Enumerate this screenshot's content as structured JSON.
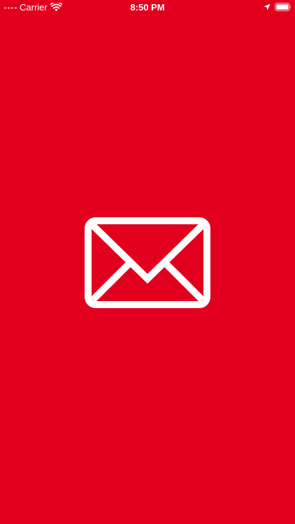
{
  "status_bar": {
    "carrier": "Carrier",
    "time": "8:50 PM",
    "signal_icon": "signal-dots-icon",
    "wifi_icon": "wifi-icon",
    "location_icon": "location-arrow-icon",
    "battery_icon": "battery-icon",
    "battery_level": 1.0
  },
  "splash": {
    "icon": "envelope-icon",
    "background_color": "#e3001e",
    "icon_color": "#ffffff"
  }
}
